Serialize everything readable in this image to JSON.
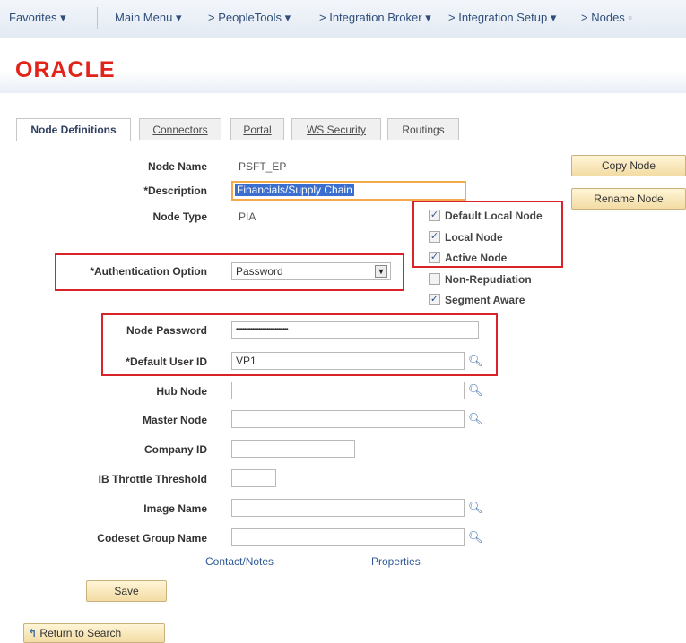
{
  "nav": {
    "favorites": "Favorites",
    "main_menu": "Main Menu",
    "crumbs": [
      "PeopleTools",
      "Integration Broker",
      "Integration Setup",
      "Nodes"
    ]
  },
  "brand": {
    "logo": "ORACLE"
  },
  "tabs": [
    {
      "label": "Node Definitions",
      "active": true
    },
    {
      "label": "Connectors",
      "active": false
    },
    {
      "label": "Portal",
      "active": false
    },
    {
      "label": "WS Security",
      "active": false
    },
    {
      "label": "Routings",
      "active": false
    }
  ],
  "form": {
    "node_name_label": "Node Name",
    "node_name_value": "PSFT_EP",
    "description_label": "*Description",
    "description_value": "Financials/Supply Chain",
    "node_type_label": "Node Type",
    "node_type_value": "PIA",
    "auth_label": "*Authentication Option",
    "auth_value": "Password",
    "node_password_label": "Node Password",
    "node_password_value": "••••••••••••••••••••••••••••••••",
    "default_user_label": "*Default User ID",
    "default_user_value": "VP1",
    "hub_node_label": "Hub Node",
    "hub_node_value": "",
    "master_node_label": "Master Node",
    "master_node_value": "",
    "company_id_label": "Company ID",
    "company_id_value": "",
    "throttle_label": "IB Throttle Threshold",
    "throttle_value": "",
    "image_name_label": "Image Name",
    "image_name_value": "",
    "codeset_label": "Codeset Group Name",
    "codeset_value": ""
  },
  "checkboxes": [
    {
      "label": "Default Local Node",
      "checked": true
    },
    {
      "label": "Local Node",
      "checked": true
    },
    {
      "label": "Active Node",
      "checked": true
    },
    {
      "label": "Non-Repudiation",
      "checked": false
    },
    {
      "label": "Segment Aware",
      "checked": true
    }
  ],
  "buttons": {
    "copy_node": "Copy Node",
    "rename_node": "Rename Node",
    "save": "Save",
    "return_to_search": "Return to Search"
  },
  "links": {
    "contact_notes": "Contact/Notes",
    "properties": "Properties"
  },
  "colors": {
    "highlight_red": "#d8232a",
    "oracle_red": "#e2231a",
    "link_blue": "#2f5a96"
  }
}
